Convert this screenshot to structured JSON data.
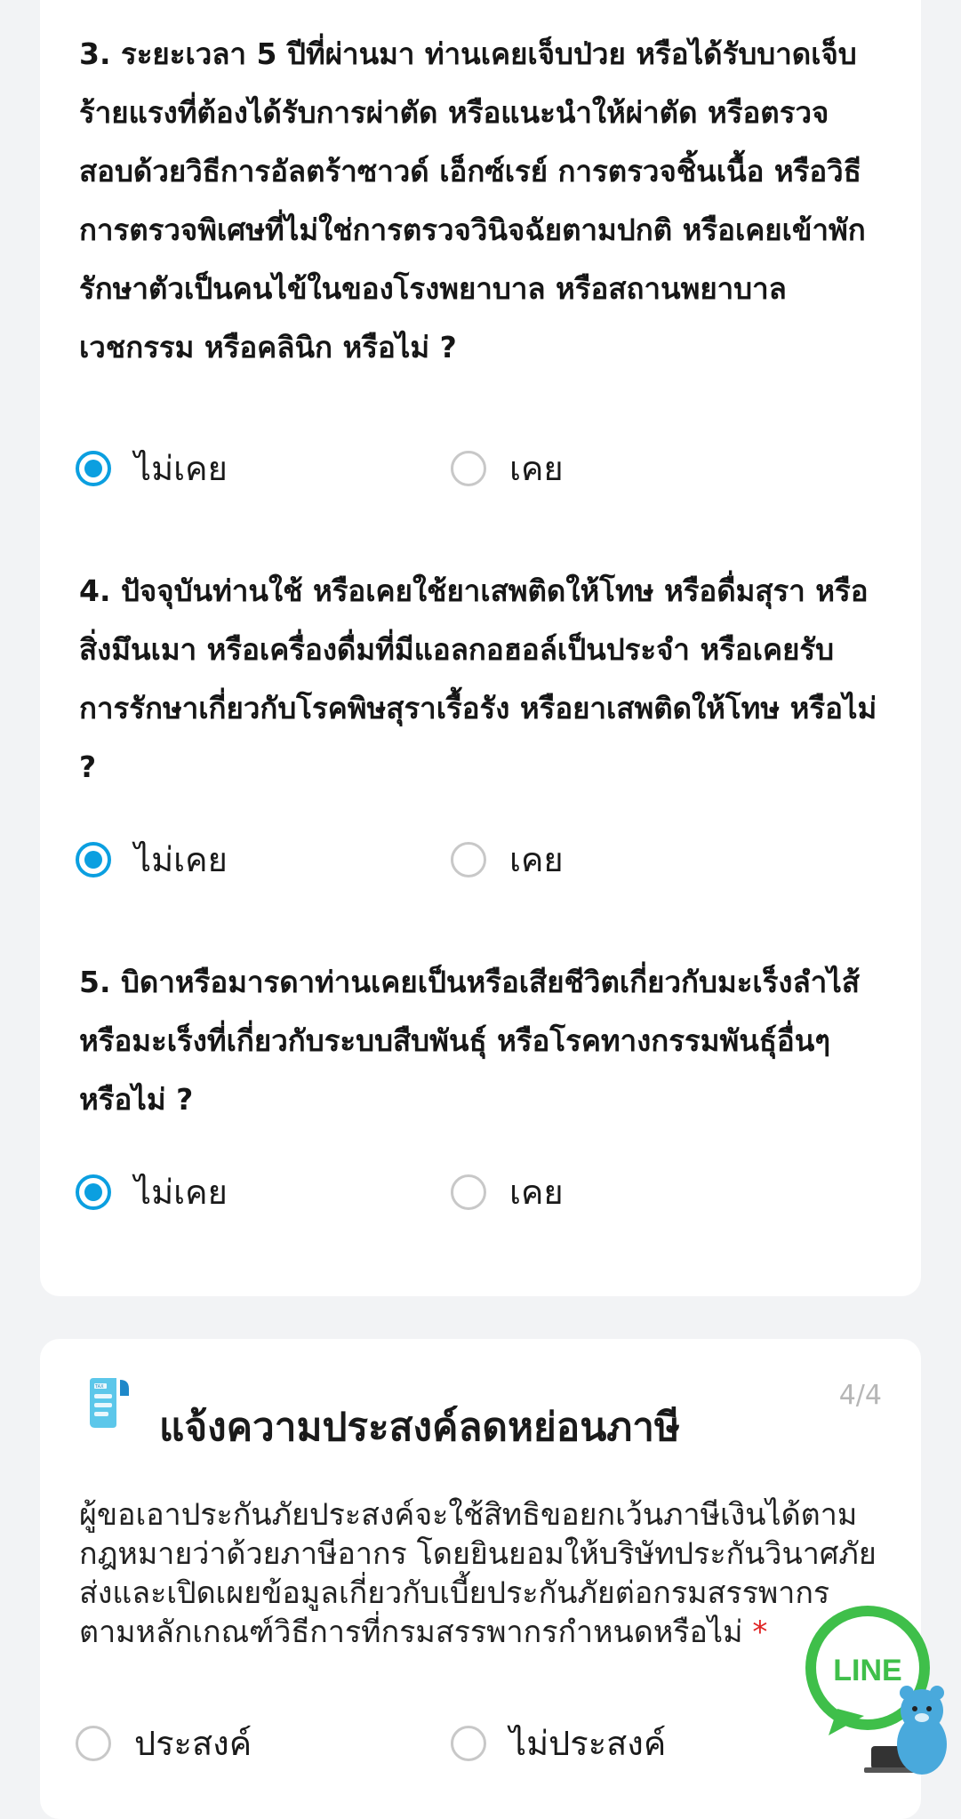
{
  "questions": [
    {
      "text": "3. ระยะเวลา 5 ปีที่ผ่านมา ท่านเคยเจ็บป่วย หรือได้รับบาดเจ็บร้ายแรงที่ต้องได้รับการผ่าตัด หรือแนะนำให้ผ่าตัด หรือตรวจสอบด้วยวิธีการอัลตร้าซาวด์ เอ็กซ์เรย์ การตรวจชิ้นเนื้อ หรือวิธีการตรวจพิเศษที่ไม่ใช่การตรวจวินิจฉัยตามปกติ หรือเคยเข้าพักรักษาตัวเป็นคนไข้ในของโรงพยาบาล หรือสถานพยาบาลเวชกรรม หรือคลินิก หรือไม่ ?",
      "options": [
        "ไม่เคย",
        "เคย"
      ],
      "selected": "ไม่เคย"
    },
    {
      "text": "4. ปัจจุบันท่านใช้ หรือเคยใช้ยาเสพติดให้โทษ หรือดื่มสุรา หรือสิ่งมึนเมา หรือเครื่องดื่มที่มีแอลกอฮอล์เป็นประจำ หรือเคยรับการรักษาเกี่ยวกับโรคพิษสุราเรื้อรัง หรือยาเสพติดให้โทษ หรือไม่ ?",
      "options": [
        "ไม่เคย",
        "เคย"
      ],
      "selected": "ไม่เคย"
    },
    {
      "text": "5. บิดาหรือมารดาท่านเคยเป็นหรือเสียชีวิตเกี่ยวกับมะเร็งลำไส้ หรือมะเร็งที่เกี่ยวกับระบบสืบพันธุ์ หรือโรคทางกรรมพันธุ์อื่นๆ หรือไม่ ?",
      "options": [
        "ไม่เคย",
        "เคย"
      ],
      "selected": "ไม่เคย"
    }
  ],
  "tax_section": {
    "title": "แจ้งความประสงค์ลดหย่อนภาษี",
    "step": "4/4",
    "icon": "tax-document-icon",
    "description": "ผู้ขอเอาประกันภัยประสงค์จะใช้สิทธิขอยกเว้นภาษีเงินได้ตามกฎหมายว่าด้วยภาษีอากร โดยยินยอมให้บริษัทประกันวินาศภัยส่งและเปิดเผยข้อมูลเกี่ยวกับเบี้ยประกันภัยต่อกรมสรรพากร ตามหลักเกณฑ์วิธีการที่กรมสรรพากรกำหนดหรือไม่",
    "required_mark": "*",
    "options": [
      "ประสงค์",
      "ไม่ประสงค์"
    ],
    "selected": null
  },
  "chat_button": {
    "label": "LINE",
    "icon": "line-chat-bear-icon"
  },
  "colors": {
    "accent": "#0b9fe0",
    "line_green": "#3fbf4a",
    "required": "#e02424"
  }
}
